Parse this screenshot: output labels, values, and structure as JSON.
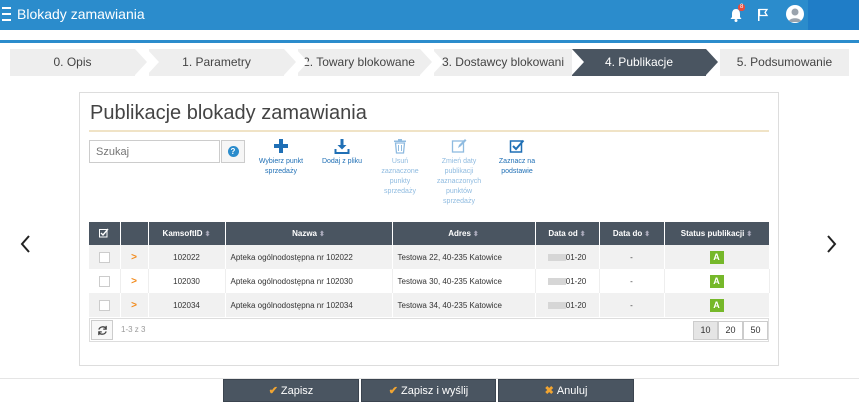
{
  "app": {
    "title": "Blokady zamawiania",
    "notification_count": "8"
  },
  "steps": [
    {
      "label": "0. Opis"
    },
    {
      "label": "1. Parametry"
    },
    {
      "label": "2. Towary blokowane"
    },
    {
      "label": "3. Dostawcy blokowani"
    },
    {
      "label": "4. Publikacje"
    },
    {
      "label": "5. Podsumowanie"
    }
  ],
  "active_step": "4. Publikacje",
  "panel": {
    "title": "Publikacje blokady zamawiania"
  },
  "search": {
    "placeholder": "Szukaj"
  },
  "toolbar": [
    {
      "label": "Wybierz punkt sprzedaży",
      "icon": "plus-icon"
    },
    {
      "label": "Dodaj z pliku",
      "icon": "download-icon"
    },
    {
      "label": "Usuń zaznaczone punkty sprzedaży",
      "icon": "trash-icon"
    },
    {
      "label": "Zmień daty publikacji zaznaczonych punktów sprzedaży",
      "icon": "edit-icon"
    },
    {
      "label": "Zaznacz na podstawie",
      "icon": "check-square-icon"
    }
  ],
  "table": {
    "columns": [
      "",
      "",
      "KamsoftID",
      "Nazwa",
      "Adres",
      "Data od",
      "Data do",
      "Status publikacji"
    ],
    "rows": [
      {
        "id": "102022",
        "name": "Apteka ogólnodostępna nr 102022",
        "address": "Testowa 22, 40-235 Katowice",
        "date_from": "01-20",
        "date_to": "-",
        "status": "A"
      },
      {
        "id": "102030",
        "name": "Apteka ogólnodostępna nr 102030",
        "address": "Testowa 30, 40-235 Katowice",
        "date_from": "01-20",
        "date_to": "-",
        "status": "A"
      },
      {
        "id": "102034",
        "name": "Apteka ogólnodostępna nr 102034",
        "address": "Testowa 34, 40-235 Katowice",
        "date_from": "01-20",
        "date_to": "-",
        "status": "A"
      }
    ],
    "pager_info": "1-3 z 3",
    "page_sizes": [
      "10",
      "20",
      "50"
    ]
  },
  "footer": {
    "save": "Zapisz",
    "save_send": "Zapisz i wyślij",
    "cancel": "Anuluj"
  },
  "colors": {
    "topbar": "#2b8ccc",
    "active_step": "#4a5561",
    "status_ok": "#76b82a",
    "accent_orange": "#f28a1a"
  }
}
